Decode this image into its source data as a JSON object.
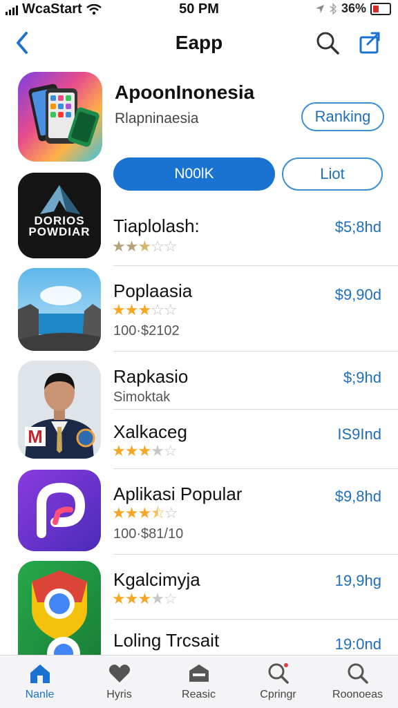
{
  "status_bar": {
    "carrier": "WcaStart",
    "time": "50 PM",
    "battery": "36%"
  },
  "nav": {
    "title": "Eapp"
  },
  "featured": {
    "title": "ApoonInonesia",
    "subtitle": "Rlapninaesia",
    "ranking_label": "Ranking",
    "primary_label": "N00lK",
    "secondary_label": "Liot"
  },
  "apps": [
    {
      "name": "Tiaplolash:",
      "price": "$5;8hd",
      "rating": 2.5,
      "icon": "dorios-popular-logo-icon",
      "icon_text": "DORIOS POWDIAR"
    },
    {
      "name": "Poplaasia",
      "price": "$9,90d",
      "rating": 3,
      "sub": "100·$2102",
      "icon": "seaside-landscape-icon"
    },
    {
      "name": "Rapkasio",
      "price": "$;9hd",
      "sub": "Simoktak",
      "icon": "portrait-photo-icon",
      "icon_text": "M"
    },
    {
      "name": "Xalkaceg",
      "price": "IS9Ind",
      "rating": 3
    },
    {
      "name": "Aplikasi Popular",
      "price": "$9,8hd",
      "rating": 3.5,
      "sub": "100·$81/10",
      "icon": "purple-p-logo-icon"
    },
    {
      "name": "Kgalcimyja",
      "price": "19,9hg",
      "rating": 3,
      "icon": "chrome-like-logo-icon"
    },
    {
      "name": "Loling Trcsait",
      "price": "19:0nd"
    }
  ],
  "tabs": [
    {
      "label": "Nanle",
      "icon": "home-icon",
      "active": true
    },
    {
      "label": "Hyris",
      "icon": "heart-icon"
    },
    {
      "label": "Reasic",
      "icon": "briefcase-icon"
    },
    {
      "label": "Cpringr",
      "icon": "search-icon"
    },
    {
      "label": "Roonoeas",
      "icon": "search-icon"
    }
  ],
  "colors": {
    "accent": "#1a73d1",
    "price": "#1f6fb8",
    "star": "#f5a623"
  }
}
